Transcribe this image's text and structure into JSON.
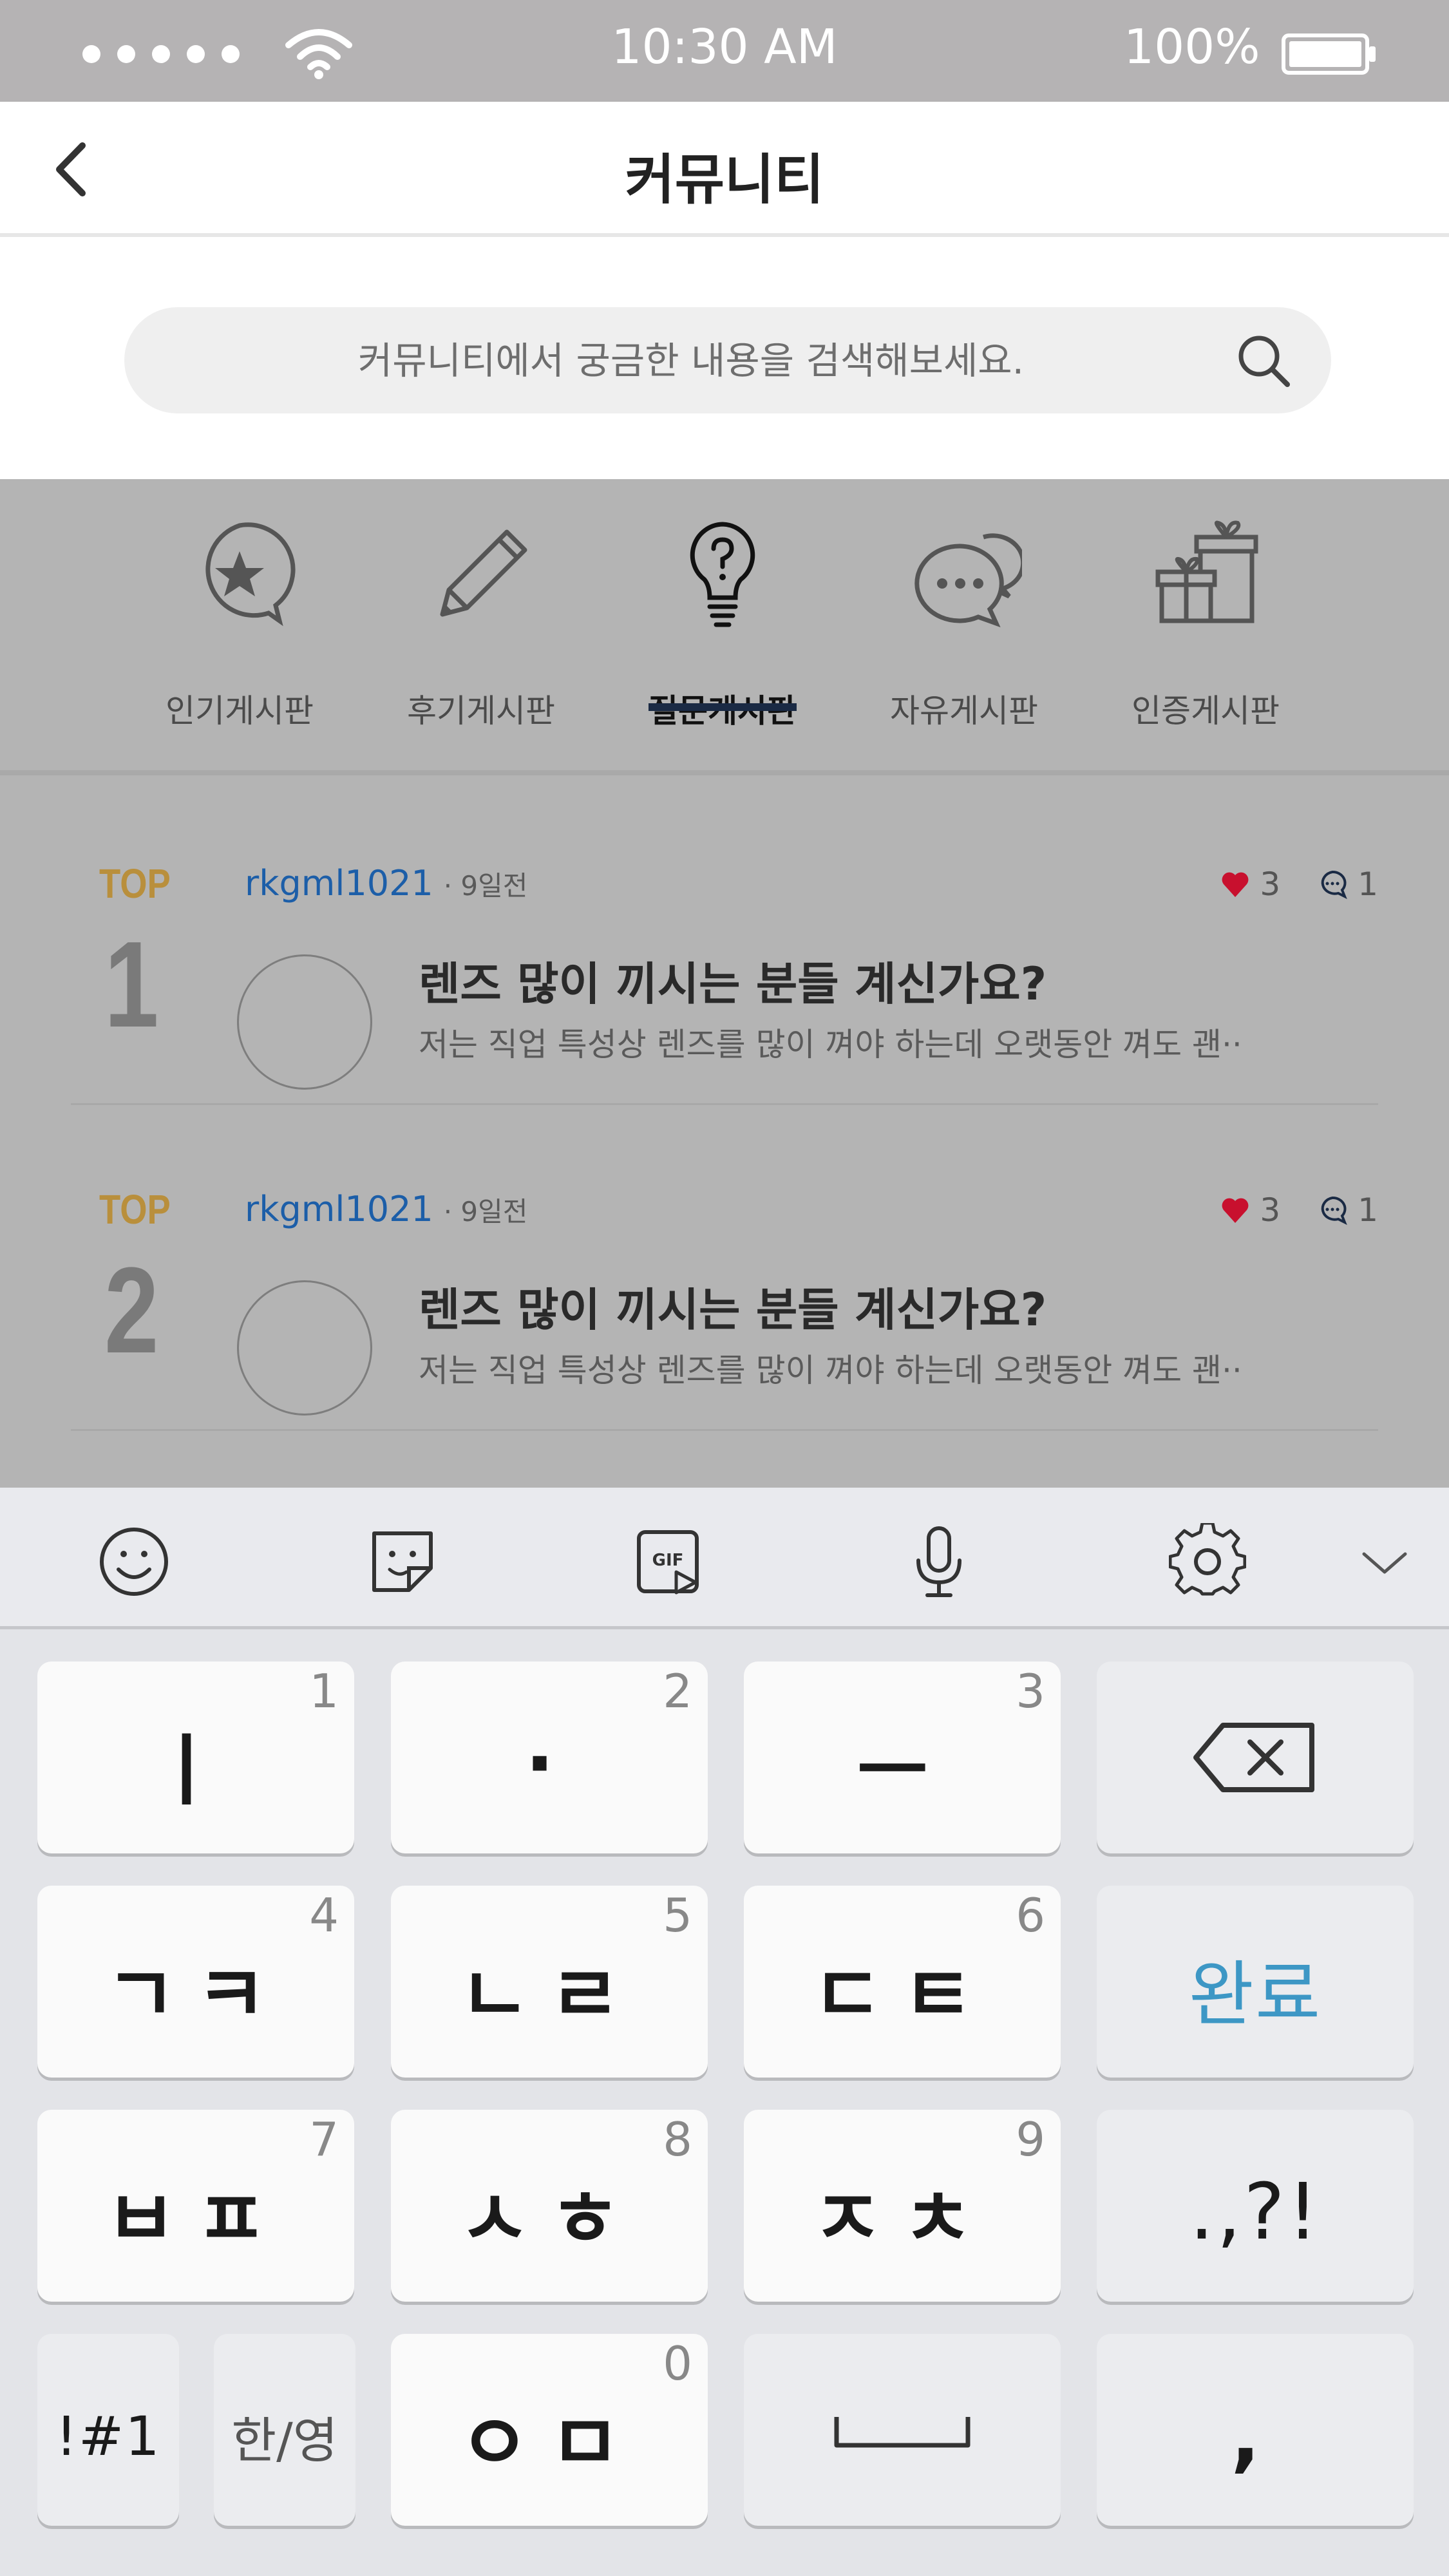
{
  "status_bar": {
    "time": "10:30 AM",
    "battery": "100%"
  },
  "header": {
    "title": "커뮤니티"
  },
  "search": {
    "placeholder": "커뮤니티에서 궁금한 내용을 검색해보세요."
  },
  "board_tabs": [
    {
      "label": "인기게시판",
      "icon": "star-bubble-icon",
      "active": false
    },
    {
      "label": "후기게시판",
      "icon": "pencil-icon",
      "active": false
    },
    {
      "label": "질문게시판",
      "icon": "lightbulb-question-icon",
      "active": true
    },
    {
      "label": "자유게시판",
      "icon": "chat-bubbles-icon",
      "active": false
    },
    {
      "label": "인증게시판",
      "icon": "gift-icon",
      "active": false
    }
  ],
  "posts": [
    {
      "rank_label": "TOP",
      "rank": "1",
      "author": "rkgml1021",
      "time": "· 9일전",
      "likes": "3",
      "comments": "1",
      "title": "렌즈 많이 끼시는 분들 계신가요?",
      "excerpt": "저는 직업 특성상 렌즈를 많이 껴야 하는데 오랫동안 껴도 괜··"
    },
    {
      "rank_label": "TOP",
      "rank": "2",
      "author": "rkgml1021",
      "time": "· 9일전",
      "likes": "3",
      "comments": "1",
      "title": "렌즈 많이 끼시는 분들 계신가요?",
      "excerpt": "저는 직업 특성상 렌즈를 많이 껴야 하는데 오랫동안 껴도 괜··"
    }
  ],
  "keyboard": {
    "toolbar": [
      "emoji-icon",
      "sticker-icon",
      "gif-icon",
      "microphone-icon",
      "settings-icon",
      "collapse-chevron-icon"
    ],
    "rows": [
      [
        {
          "label": "ㅣ",
          "num": "1"
        },
        {
          "label": "·",
          "num": "2"
        },
        {
          "label": "ㅡ",
          "num": "3"
        },
        {
          "label": "backspace",
          "num": ""
        }
      ],
      [
        {
          "label": "ㄱㅋ",
          "num": "4"
        },
        {
          "label": "ㄴㄹ",
          "num": "5"
        },
        {
          "label": "ㄷㅌ",
          "num": "6"
        },
        {
          "label": "완료",
          "num": ""
        }
      ],
      [
        {
          "label": "ㅂㅍ",
          "num": "7"
        },
        {
          "label": "ㅅㅎ",
          "num": "8"
        },
        {
          "label": "ㅈㅊ",
          "num": "9"
        },
        {
          "label": ".,?!",
          "num": ""
        }
      ],
      [
        {
          "label": "!#1",
          "num": ""
        },
        {
          "label": "한/영",
          "num": ""
        },
        {
          "label": "ㅇㅁ",
          "num": "0"
        },
        {
          "label": "space",
          "num": ""
        },
        {
          "label": ",",
          "num": ""
        }
      ]
    ],
    "accent_color": "#3d97c5"
  },
  "colors": {
    "status_bar": "#b5b3b4",
    "dim_overlay": "#b4b4b4",
    "author": "#1c5ea8",
    "top_rank": "#b98f3c",
    "heart": "#c8102e",
    "tab_underline": "#1a2a44"
  }
}
